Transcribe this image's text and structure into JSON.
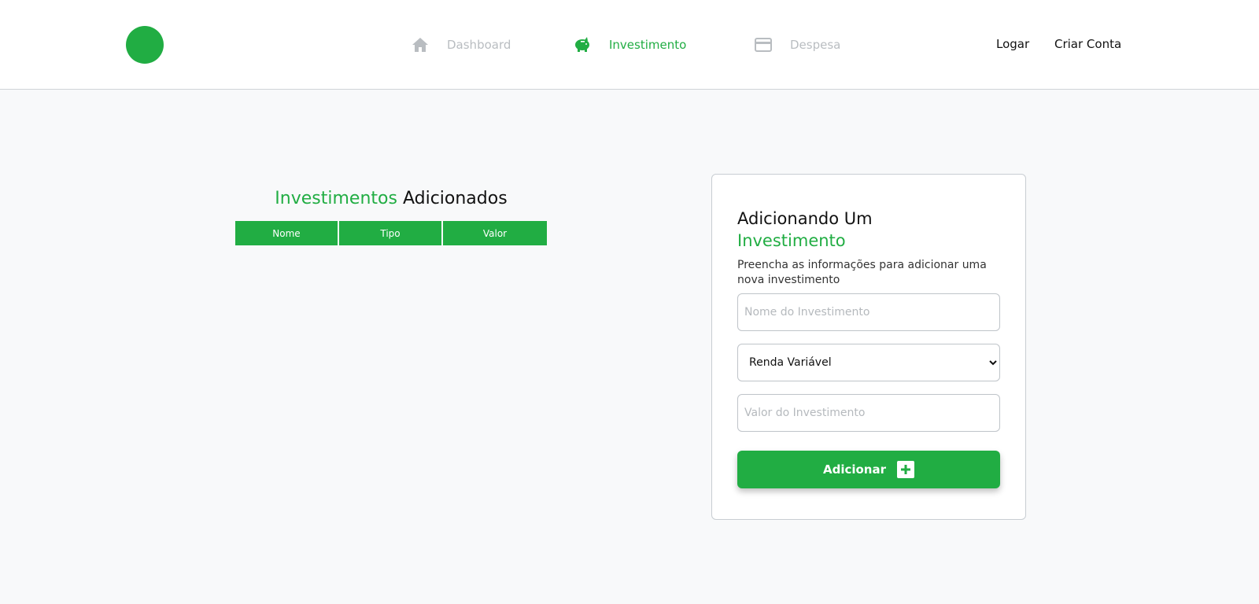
{
  "nav": {
    "items": [
      {
        "label": "Dashboard",
        "icon": "home-icon"
      },
      {
        "label": "Investimento",
        "icon": "piggy-bank-icon"
      },
      {
        "label": "Despesa",
        "icon": "credit-card-icon"
      }
    ],
    "login_label": "Logar",
    "signup_label": "Criar Conta"
  },
  "colors": {
    "accent": "#21ad43",
    "inactive_nav": "#b9bdc1",
    "background": "#f8f9fa"
  },
  "investments": {
    "title_accent": "Investimentos",
    "title_rest": "Adicionados",
    "columns": [
      "Nome",
      "Tipo",
      "Valor"
    ],
    "rows": []
  },
  "form": {
    "title_line1": "Adicionando Um",
    "title_line2": "Investimento",
    "description": "Preencha as informações para adicionar uma nova investimento",
    "name_placeholder": "Nome do Investimento",
    "type_selected": "Renda Variável",
    "value_placeholder": "Valor do Investimento",
    "submit_label": "Adicionar"
  }
}
